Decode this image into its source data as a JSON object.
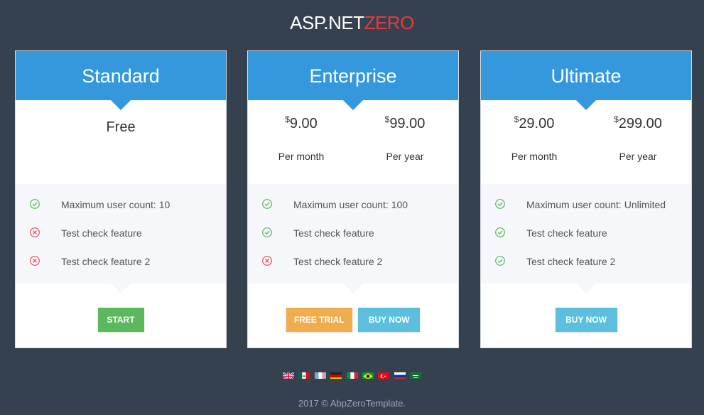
{
  "logo": {
    "main": "ASP.NET",
    "accent": "ZERO"
  },
  "plans": [
    {
      "name": "Standard",
      "price_free": "Free",
      "features": [
        {
          "text": "Maximum user count: 10",
          "status": "check"
        },
        {
          "text": "Test check feature",
          "status": "cross"
        },
        {
          "text": "Test check feature 2",
          "status": "cross"
        }
      ],
      "buttons": [
        {
          "label": "START",
          "color": "#5cb85c"
        }
      ]
    },
    {
      "name": "Enterprise",
      "monthly": {
        "currency": "$",
        "amount": "9.00",
        "period": "Per month"
      },
      "yearly": {
        "currency": "$",
        "amount": "99.00",
        "period": "Per year"
      },
      "features": [
        {
          "text": "Maximum user count: 100",
          "status": "check"
        },
        {
          "text": "Test check feature",
          "status": "check"
        },
        {
          "text": "Test check feature 2",
          "status": "cross"
        }
      ],
      "buttons": [
        {
          "label": "FREE TRIAL",
          "color": "#f0ad4e"
        },
        {
          "label": "BUY NOW",
          "color": "#5bc0de"
        }
      ]
    },
    {
      "name": "Ultimate",
      "monthly": {
        "currency": "$",
        "amount": "29.00",
        "period": "Per month"
      },
      "yearly": {
        "currency": "$",
        "amount": "299.00",
        "period": "Per year"
      },
      "features": [
        {
          "text": "Maximum user count: Unlimited",
          "status": "check"
        },
        {
          "text": "Test check feature",
          "status": "check"
        },
        {
          "text": "Test check feature 2",
          "status": "check"
        }
      ],
      "buttons": [
        {
          "label": "BUY NOW",
          "color": "#5bc0de"
        }
      ]
    }
  ],
  "colors": {
    "background": "#364150",
    "header": "#3598dc",
    "check": "#5cb85c",
    "cross": "#e7505a"
  },
  "languages": [
    "english-flag-icon",
    "spanish-mexico-flag-icon",
    "french-flag-icon",
    "german-flag-icon",
    "italian-flag-icon",
    "portuguese-brazil-flag-icon",
    "turkish-flag-icon",
    "russian-flag-icon",
    "arabic-flag-icon"
  ],
  "footer": {
    "text": "2017 © AbpZeroTemplate."
  }
}
